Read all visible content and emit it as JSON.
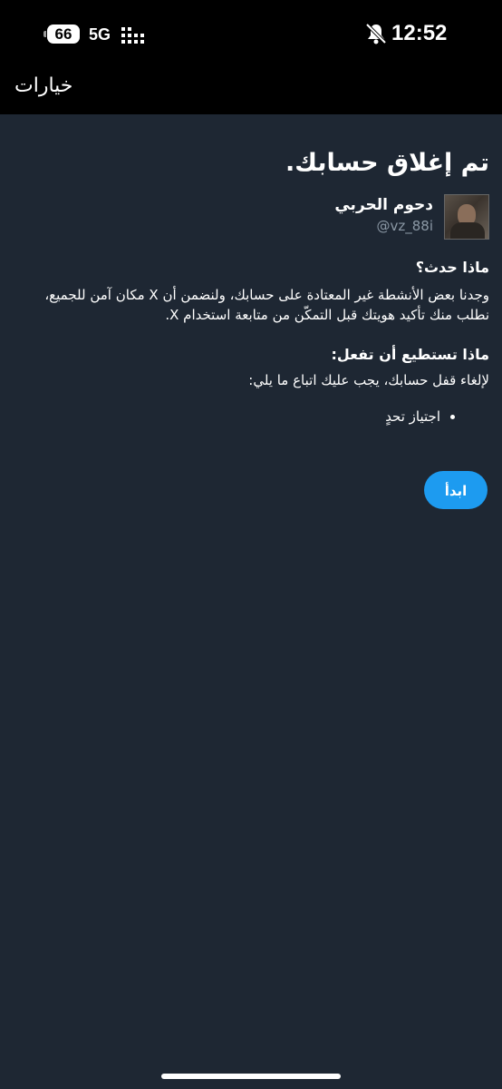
{
  "status_bar": {
    "battery": "66",
    "network": "5G",
    "time": "12:52",
    "icons": [
      "battery-icon",
      "signal-icon",
      "bell-slash-icon"
    ]
  },
  "top_bar": {
    "title": "خيارات"
  },
  "main": {
    "heading": "تم إغلاق حسابك.",
    "profile": {
      "display_name": "دحوم الحربي",
      "handle": "@vz_88i"
    },
    "what_happened": {
      "title": "ماذا حدث؟",
      "body": "وجدنا بعض الأنشطة غير المعتادة على حسابك، ولنضمن أن X مكان آمن للجميع، نطلب منك تأكيد هويتك قبل التمكّن من متابعة استخدام X."
    },
    "what_you_can_do": {
      "title": "ماذا تستطيع أن تفعل:",
      "body": "لإلغاء قفل حسابك، يجب عليك اتباع ما يلي:",
      "steps": [
        "اجتياز تحدٍ"
      ]
    },
    "start_button": "ابدأ"
  },
  "colors": {
    "background": "#1e2733",
    "accent": "#1d9bf0",
    "secondary_text": "#8b98a5"
  }
}
